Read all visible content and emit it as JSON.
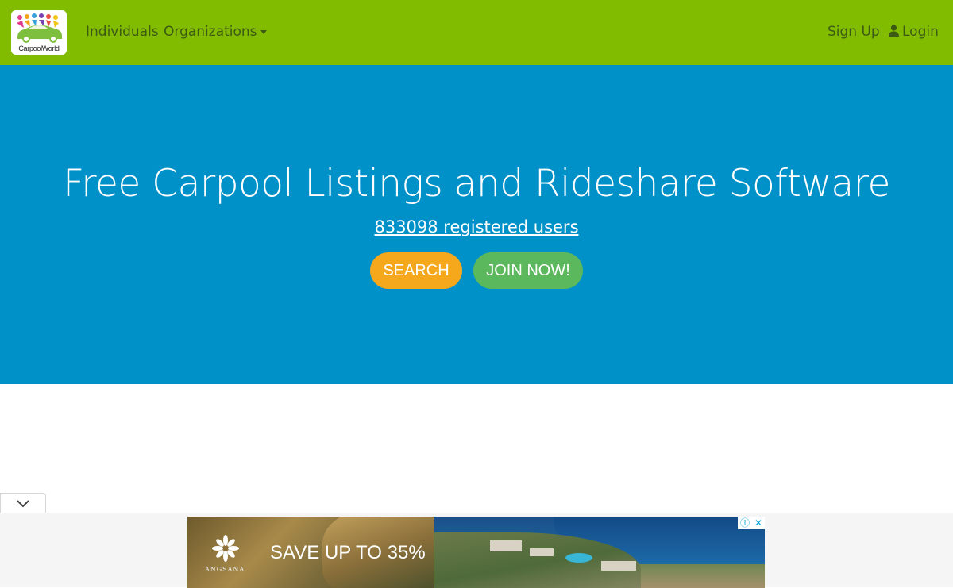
{
  "navbar": {
    "logo_text": "CarpoolWorld",
    "links": {
      "individuals": "Individuals",
      "organizations": "Organizations",
      "sign_up": "Sign Up",
      "login": "Login"
    }
  },
  "hero": {
    "title": "Free Carpool Listings and Rideshare Software",
    "users_link": "833098 registered users",
    "search_button": "SEARCH",
    "join_button": "JOIN NOW!"
  },
  "ad": {
    "brand": "ANGSANA",
    "headline": "SAVE UP TO 35%",
    "info_icon": "ⓘ",
    "close_icon": "✕"
  },
  "colors": {
    "navbar_bg": "#82bc00",
    "hero_bg": "#0091c9",
    "search_button": "#f5a81c",
    "join_button": "#5cb85c"
  }
}
